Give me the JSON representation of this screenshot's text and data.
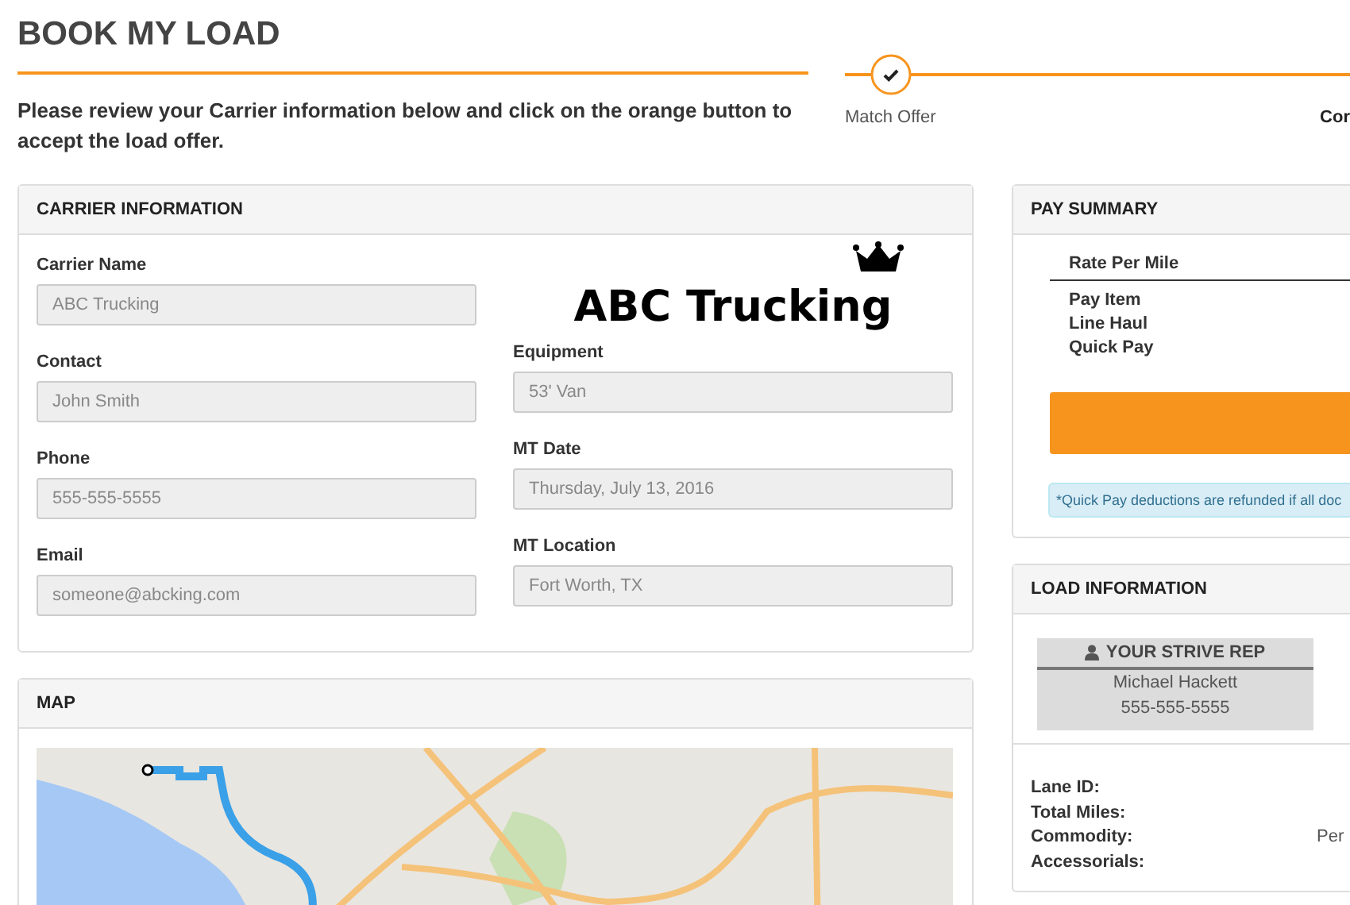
{
  "page": {
    "title": "BOOK MY LOAD",
    "instructions": "Please review your Carrier information below and click on the orange button to accept the load offer."
  },
  "steps": [
    {
      "label": "Match Offer",
      "completed": true,
      "current": false
    },
    {
      "label": "Cor",
      "completed": false,
      "current": true
    }
  ],
  "carrier_information": {
    "title": "CARRIER INFORMATION",
    "logo_text": "ABC Trucking",
    "left_fields": [
      {
        "label": "Carrier Name",
        "value": "ABC Trucking",
        "disabled": true
      },
      {
        "label": "Contact",
        "value": "John Smith",
        "disabled": true
      },
      {
        "label": "Phone",
        "value": "555-555-5555",
        "disabled": true
      },
      {
        "label": "Email",
        "value": "someone@abcking.com",
        "disabled": true
      }
    ],
    "right_fields": [
      {
        "label": "Equipment",
        "value": "53' Van",
        "disabled": true
      },
      {
        "label": "MT Date",
        "value": "Thursday, July 13, 2016",
        "disabled": true
      },
      {
        "label": "MT Location",
        "value": "Fort Worth, TX",
        "disabled": true
      }
    ]
  },
  "map": {
    "title": "MAP"
  },
  "pay_summary": {
    "title": "PAY SUMMARY",
    "rate_label": "Rate Per Mile",
    "column_heading": "Pay Item",
    "rows": [
      "Line Haul",
      "Quick Pay"
    ],
    "note": "*Quick Pay deductions are refunded if all doc"
  },
  "load_information": {
    "title": "LOAD INFORMATION",
    "rep": {
      "heading": "YOUR STRIVE REP",
      "name": "Michael Hackett",
      "phone": "555-555-5555"
    },
    "details": [
      {
        "label": "Lane ID:"
      },
      {
        "label": "Total Miles:"
      },
      {
        "label": "Commodity:",
        "value": "Per"
      },
      {
        "label": "Accessorials:"
      }
    ]
  }
}
